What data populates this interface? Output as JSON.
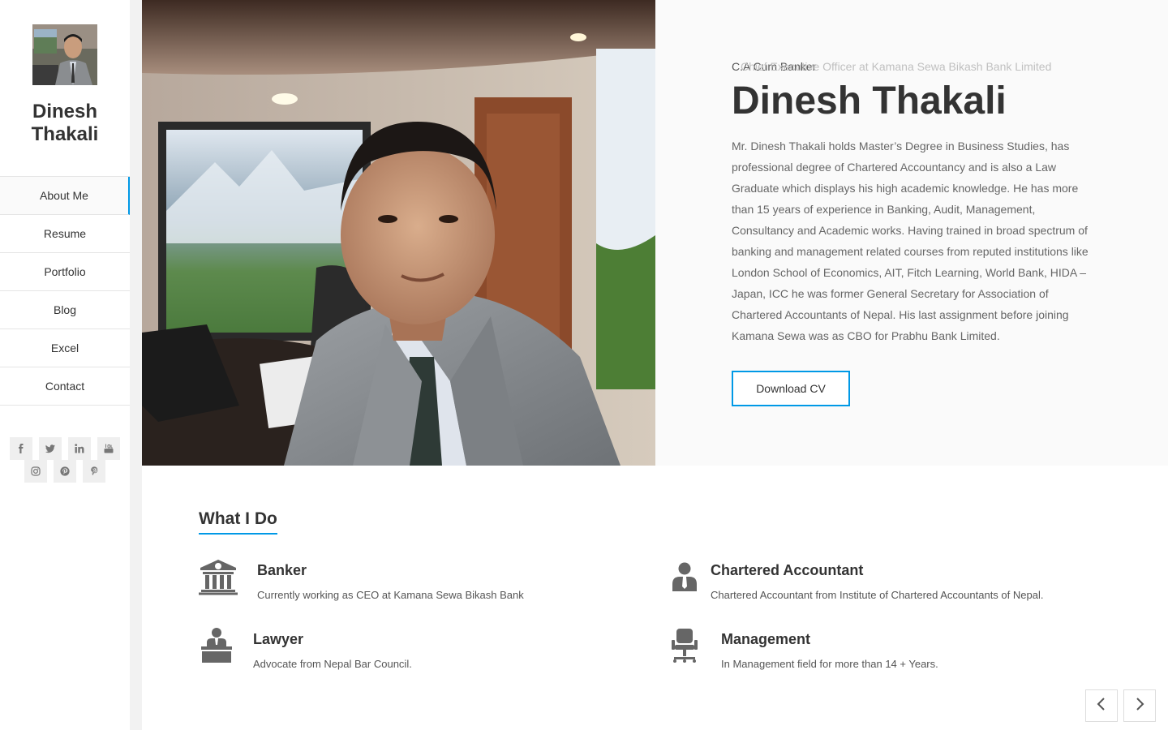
{
  "sidebar": {
    "title": "Dinesh Thakali",
    "nav": [
      {
        "label": "About Me"
      },
      {
        "label": "Resume"
      },
      {
        "label": "Portfolio"
      },
      {
        "label": "Blog"
      },
      {
        "label": "Excel"
      },
      {
        "label": "Contact"
      }
    ],
    "socials": [
      "facebook-icon",
      "twitter-icon",
      "linkedin-icon",
      "youtube-icon",
      "instagram-icon",
      "pinterest-icon",
      "pinterest-p-icon"
    ]
  },
  "hero": {
    "subtitle_a": "C.A Cum Banker",
    "subtitle_b": "Chief Executive Officer at Kamana Sewa Bikash Bank Limited",
    "name": "Dinesh Thakali",
    "bio": "Mr. Dinesh Thakali holds Master’s Degree in Business Studies, has professional degree of Chartered Accountancy and is also a Law Graduate which displays his high academic knowledge. He has more than 15 years of experience in Banking, Audit, Management, Consultancy and Academic works. Having trained in broad spectrum of banking and management related courses from reputed institutions like London School of Economics, AIT, Fitch Learning, World Bank, HIDA – Japan, ICC he was former General Secretary for Association of Chartered Accountants of Nepal. His last assignment before joining Kamana Sewa was as CBO for Prabhu Bank Limited.",
    "cv_button": "Download CV"
  },
  "services": {
    "title": "What I Do",
    "items": [
      {
        "title": "Banker",
        "desc": "Currently working as CEO at Kamana Sewa Bikash Bank",
        "icon": "bank-icon"
      },
      {
        "title": "Chartered Accountant",
        "desc": "Chartered Accountant from Institute of Chartered Accountants of Nepal.",
        "icon": "user-tie-icon"
      },
      {
        "title": "Lawyer",
        "desc": "Advocate from Nepal Bar Council.",
        "icon": "lawyer-icon"
      },
      {
        "title": "Management",
        "desc": "In Management field for more than 14 + Years.",
        "icon": "office-chair-icon"
      }
    ]
  },
  "colors": {
    "accent": "#0099e6",
    "text": "#333333",
    "muted": "#666666",
    "sidebar_shadow": "#f2f2f2",
    "hero_bg": "#fafafa"
  }
}
